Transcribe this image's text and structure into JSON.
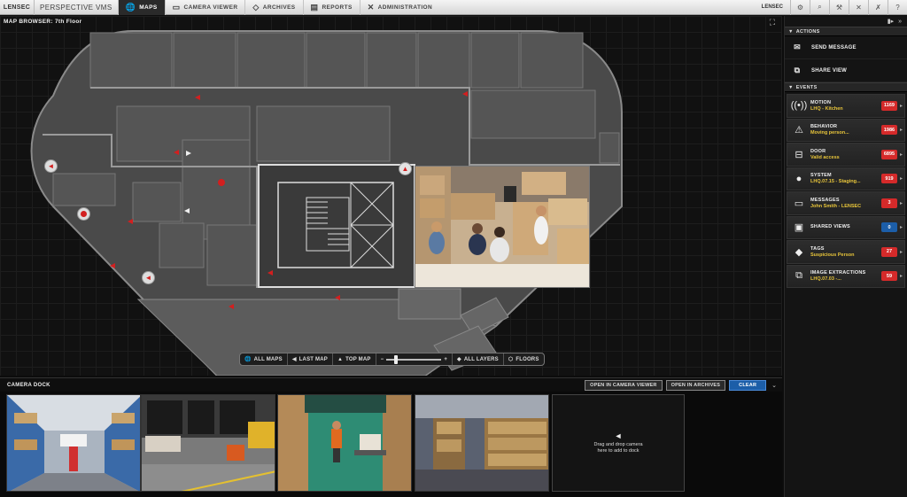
{
  "app": {
    "logo": "LENSEC",
    "product": "PERSPECTIVE VMS",
    "user": "LENSEC"
  },
  "nav": [
    {
      "label": "MAPS",
      "icon": "globe-icon",
      "active": true
    },
    {
      "label": "CAMERA VIEWER",
      "icon": "monitor-icon",
      "active": false
    },
    {
      "label": "ARCHIVES",
      "icon": "archives-icon",
      "active": false
    },
    {
      "label": "REPORTS",
      "icon": "reports-icon",
      "active": false
    },
    {
      "label": "ADMINISTRATION",
      "icon": "tools-icon",
      "active": false
    }
  ],
  "map_browser": {
    "title": "MAP BROWSER: 7th Floor"
  },
  "map_toolbar": {
    "all_maps": "ALL MAPS",
    "last_map": "LAST MAP",
    "top_map": "TOP MAP",
    "all_layers": "ALL LAYERS",
    "floors": "FLOORS",
    "zoom_level": 0.15
  },
  "camera_dock": {
    "title": "CAMERA DOCK",
    "open_viewer": "OPEN IN CAMERA VIEWER",
    "open_archives": "OPEN IN ARCHIVES",
    "clear": "CLEAR",
    "drop_text": "Drag and drop camera here to add to dock"
  },
  "actions": {
    "header": "ACTIONS",
    "items": [
      {
        "label": "SEND MESSAGE",
        "icon": "envelope-icon"
      },
      {
        "label": "SHARE VIEW",
        "icon": "share-view-icon"
      }
    ]
  },
  "events": {
    "header": "EVENTS",
    "items": [
      {
        "name": "MOTION",
        "sub": "LHQ - Kitchen",
        "count": "1169",
        "color": "#d52a2a",
        "icon": "motion-icon"
      },
      {
        "name": "BEHAVIOR",
        "sub": "Moving person...",
        "count": "1986",
        "color": "#d52a2a",
        "icon": "warning-icon"
      },
      {
        "name": "DOOR",
        "sub": "Valid access",
        "count": "6895",
        "color": "#d52a2a",
        "icon": "door-icon"
      },
      {
        "name": "SYSTEM",
        "sub": "LHQ.07.15 - Staging...",
        "count": "919",
        "color": "#d52a2a",
        "icon": "alert-icon"
      },
      {
        "name": "MESSAGES",
        "sub": "John Smith - LENSEC",
        "count": "3",
        "color": "#d52a2a",
        "icon": "message-icon"
      },
      {
        "name": "SHARED VIEWS",
        "sub": "",
        "count": "0",
        "color": "#1c5ea8",
        "icon": "shared-views-icon"
      },
      {
        "name": "TAGS",
        "sub": "Suspicious Person",
        "count": "27",
        "color": "#d52a2a",
        "icon": "tag-icon"
      },
      {
        "name": "IMAGE EXTRACTIONS",
        "sub": "LHQ.07.03 -...",
        "count": "59",
        "color": "#d52a2a",
        "icon": "image-extraction-icon"
      }
    ]
  }
}
